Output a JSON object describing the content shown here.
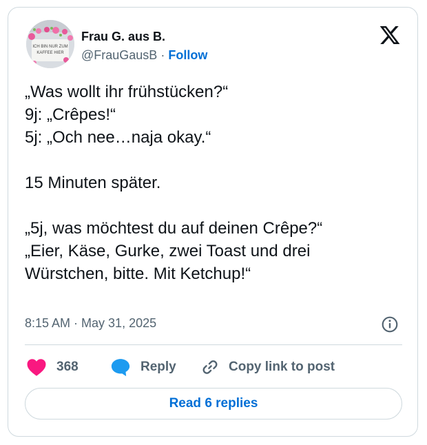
{
  "author": {
    "display_name": "Frau G. aus B.",
    "handle": "@FrauGausB",
    "separator": "·",
    "follow_label": "Follow",
    "avatar_text_1": "ICH BIN NUR ZUM",
    "avatar_text_2": "KAFFEE HIER"
  },
  "tweet": {
    "lines": [
      "„Was wollt ihr frühstücken?“",
      "9j: „Crêpes!“",
      "5j: „Och nee…naja okay.“",
      "",
      "15 Minuten später.",
      "",
      "„5j, was möchtest du auf deinen Crêpe?“",
      "„Eier, Käse, Gurke, zwei Toast und drei",
      "Würstchen, bitte. Mit Ketchup!“"
    ],
    "timestamp": "8:15 AM · May 31, 2025"
  },
  "actions": {
    "like_count": "368",
    "reply_label": "Reply",
    "copy_link_label": "Copy link to post"
  },
  "footer": {
    "read_replies_label": "Read 6 replies"
  },
  "colors": {
    "text": "#0f1419",
    "muted": "#536471",
    "link": "#006fd6",
    "heart": "#f91880",
    "reply_bubble": "#1d9bf0",
    "border": "#cfd9de"
  },
  "icons": [
    "x-logo-icon",
    "info-icon",
    "heart-icon",
    "reply-bubble-icon",
    "link-icon"
  ]
}
